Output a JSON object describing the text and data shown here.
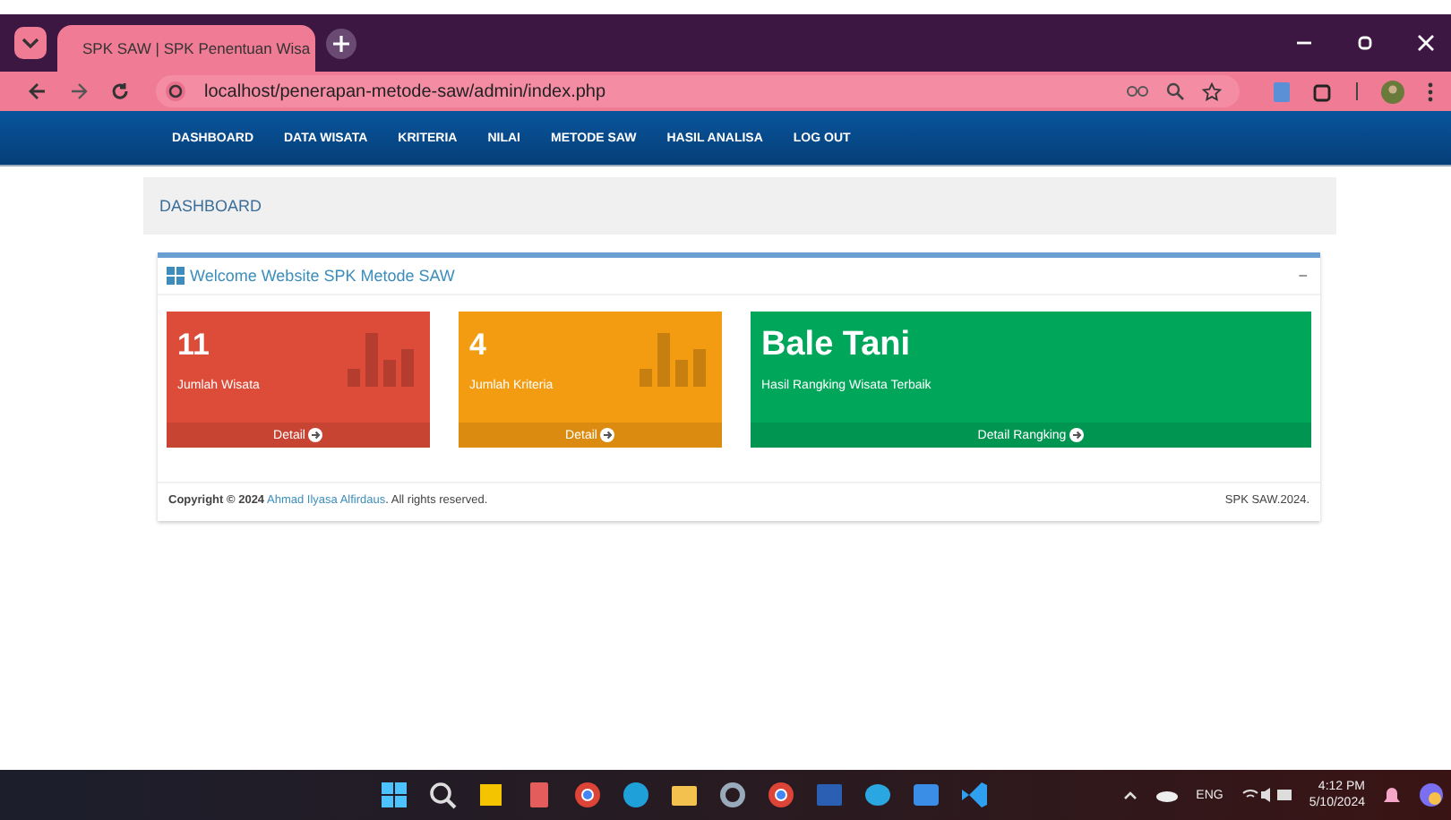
{
  "browser": {
    "tab_title": "SPK SAW | SPK Penentuan Wisa",
    "url": "localhost/penerapan-metode-saw/admin/index.php"
  },
  "nav": [
    "DASHBOARD",
    "DATA WISATA",
    "KRITERIA",
    "NILAI",
    "METODE SAW",
    "HASIL ANALISA",
    "LOG OUT"
  ],
  "page_header": "DASHBOARD",
  "box": {
    "title": "Welcome Website SPK Metode SAW",
    "collapse": "−"
  },
  "cards": [
    {
      "kind": "stat",
      "value": "11",
      "label": "Jumlah Wisata",
      "link": "Detail",
      "color": "#dd4b39"
    },
    {
      "kind": "stat",
      "value": "4",
      "label": "Jumlah Kriteria",
      "link": "Detail",
      "color": "#f39c12"
    },
    {
      "kind": "highlight",
      "value": "Bale Tani",
      "label": "Hasil Rangking Wisata Terbaik",
      "link": "Detail Rangking",
      "color": "#00a65a"
    }
  ],
  "footer": {
    "copyright": "Copyright © 2024",
    "author": "Ahmad Ilyasa Alfirdaus",
    "rest": ". All rights reserved.",
    "right": "SPK SAW.2024."
  },
  "taskbar": {
    "language": "ENG",
    "time": "4:12 PM",
    "date": "5/10/2024"
  }
}
